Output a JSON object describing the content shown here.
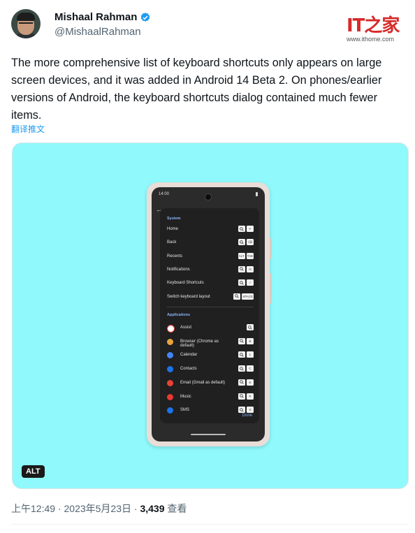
{
  "author": {
    "name": "Mishaal Rahman",
    "handle": "@MishaalRahman",
    "verified_color": "#1d9bf0"
  },
  "watermark": {
    "logo_text": "IT之家",
    "url": "www.ithome.com"
  },
  "tweet": {
    "text": "The more comprehensive list of keyboard shortcuts only appears on large screen devices, and it was added in Android 14 Beta 2. On phones/earlier versions of Android, the keyboard shortcuts dialog contained much fewer items.",
    "translate_label": "翻译推文",
    "alt_badge": "ALT"
  },
  "phone": {
    "status_time": "14:00",
    "system_section": "System",
    "system_rows": [
      {
        "label": "Home",
        "keys": [
          "search-icon",
          "↵"
        ]
      },
      {
        "label": "Back",
        "keys": [
          "search-icon",
          "⌫"
        ]
      },
      {
        "label": "Recents",
        "keys": [
          "ALT",
          "TAB"
        ]
      },
      {
        "label": "Notifications",
        "keys": [
          "search-icon",
          "N"
        ]
      },
      {
        "label": "Keyboard Shortcuts",
        "keys": [
          "search-icon",
          "/"
        ]
      },
      {
        "label": "Switch keyboard layout",
        "keys": [
          "search-icon",
          "SPACE"
        ]
      }
    ],
    "apps_section": "Applications",
    "app_rows": [
      {
        "label": "Assist",
        "icon": "google-icon",
        "color": "#ffffff",
        "keys": [
          "search-icon"
        ]
      },
      {
        "label": "Browser (Chrome as default)",
        "icon": "chrome-icon",
        "color": "#e8a33c",
        "keys": [
          "search-icon",
          "B"
        ]
      },
      {
        "label": "Calendar",
        "icon": "calendar-icon",
        "color": "#4285f4",
        "keys": [
          "search-icon",
          "L"
        ]
      },
      {
        "label": "Contacts",
        "icon": "contacts-icon",
        "color": "#1a73e8",
        "keys": [
          "search-icon",
          "C"
        ]
      },
      {
        "label": "Email (Gmail as default)",
        "icon": "gmail-icon",
        "color": "#ea4335",
        "keys": [
          "search-icon",
          "E"
        ]
      },
      {
        "label": "Music",
        "icon": "music-icon",
        "color": "#e53935",
        "keys": [
          "search-icon",
          "P"
        ]
      },
      {
        "label": "SMS",
        "icon": "messages-icon",
        "color": "#1a73e8",
        "keys": [
          "search-icon",
          "S"
        ]
      }
    ],
    "done_label": "Done"
  },
  "footer": {
    "time": "上午12:49",
    "separator": "·",
    "date": "2023年5月23日",
    "views_count": "3,439",
    "views_label": "查看"
  },
  "colors": {
    "media_background": "#8ff9fb",
    "link": "#1d9bf0",
    "accent_dialog": "#8ab4f8"
  }
}
